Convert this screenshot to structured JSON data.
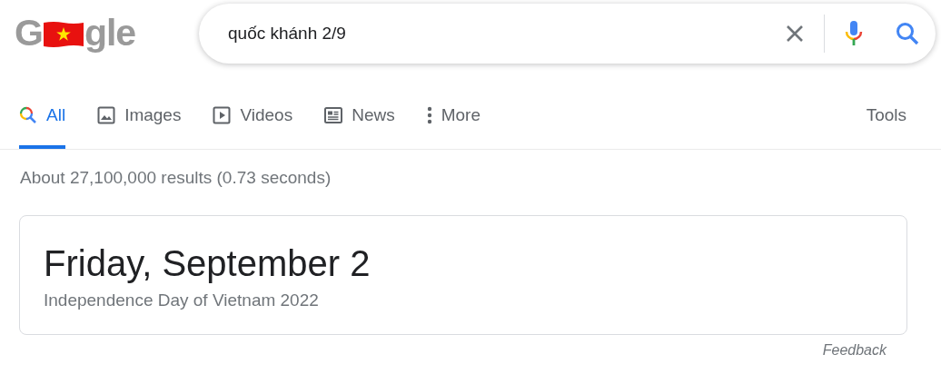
{
  "logo": {
    "start": "G",
    "end": "gle"
  },
  "search": {
    "value": "quốc khánh 2/9"
  },
  "tabs": [
    {
      "label": "All",
      "kind": "search",
      "selected": true
    },
    {
      "label": "Images",
      "kind": "images",
      "selected": false
    },
    {
      "label": "Videos",
      "kind": "videos",
      "selected": false
    },
    {
      "label": "News",
      "kind": "news",
      "selected": false
    },
    {
      "label": "More",
      "kind": "more",
      "selected": false
    }
  ],
  "tools": "Tools",
  "result_stats": "About 27,100,000 results (0.73 seconds)",
  "card": {
    "title": "Friday, September 2",
    "subtitle": "Independence Day of Vietnam 2022"
  },
  "feedback": "Feedback"
}
